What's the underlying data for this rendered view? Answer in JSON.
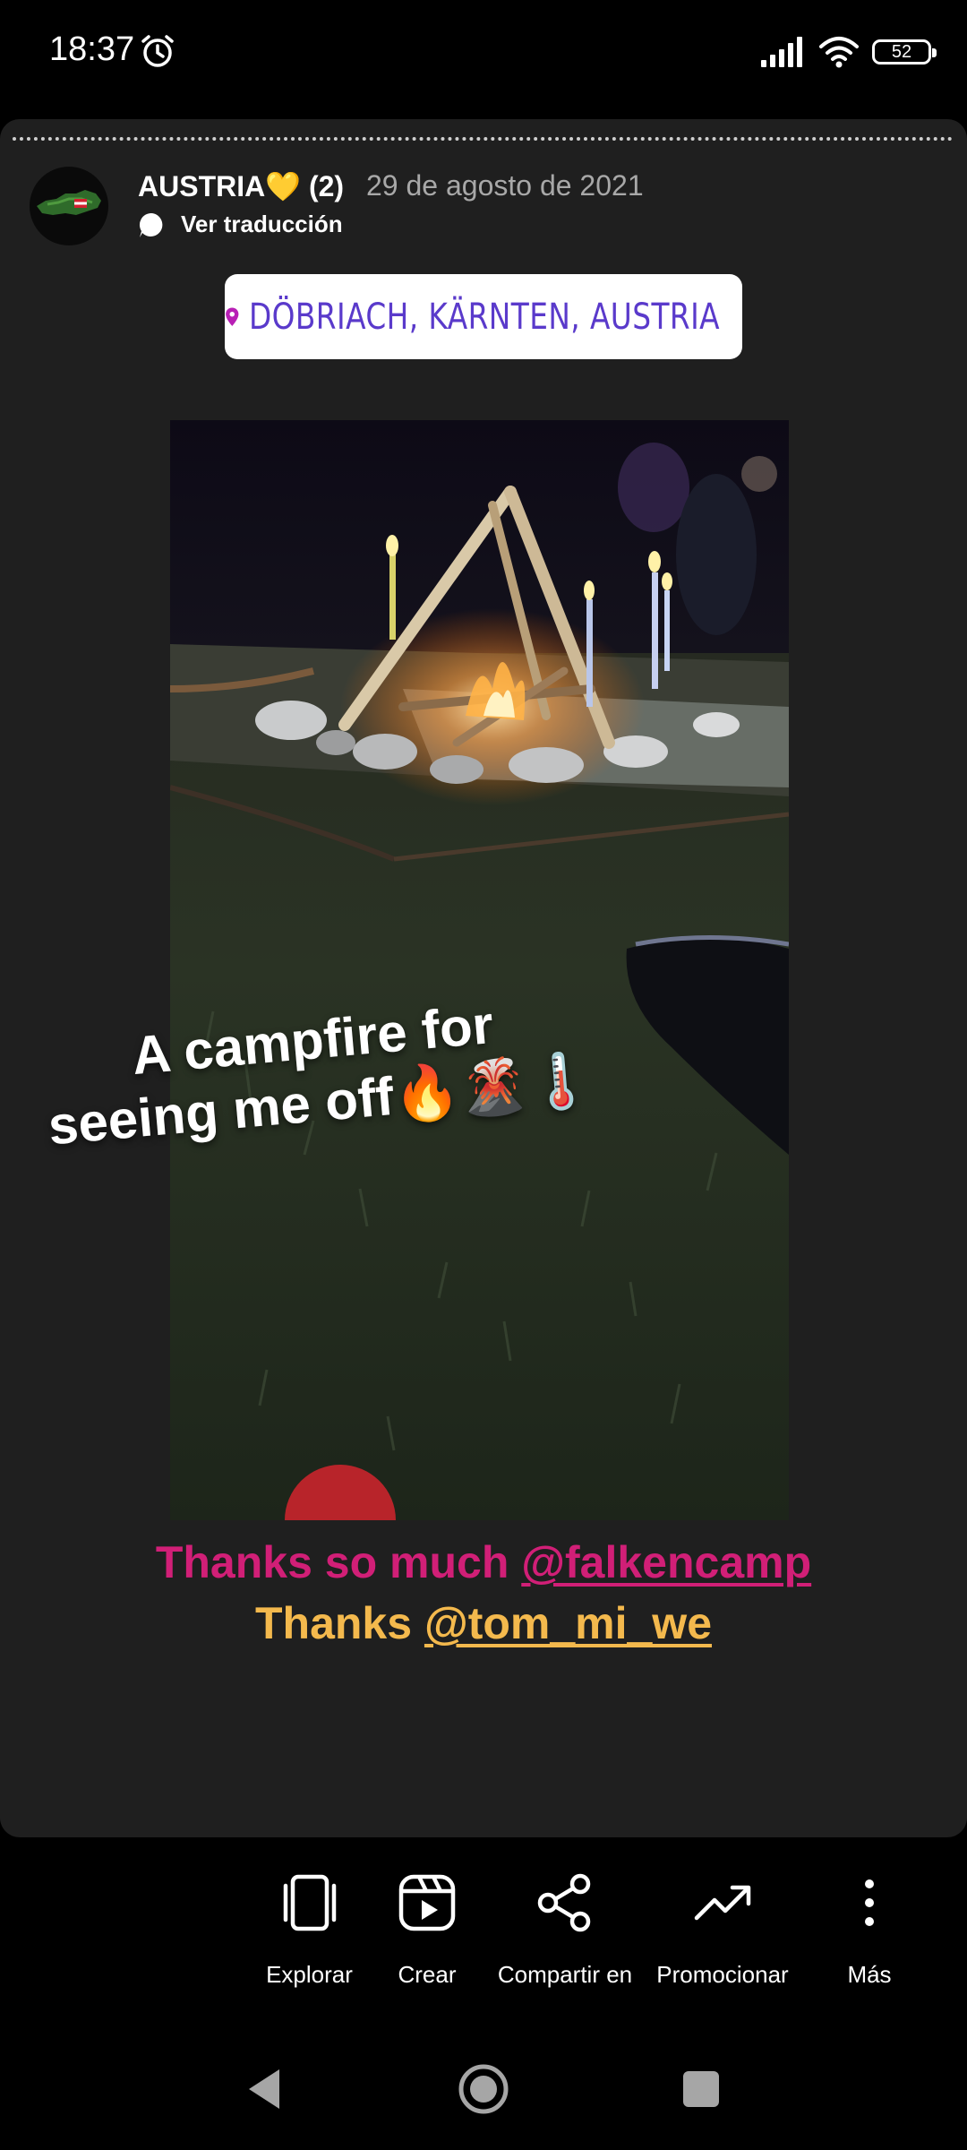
{
  "status_bar": {
    "time": "18:37",
    "battery": "52",
    "icons": [
      "alarm-icon",
      "signal-icon",
      "wifi-icon",
      "battery-icon"
    ]
  },
  "story": {
    "username": "AUSTRIA💛 (2)",
    "date": "29 de agosto de 2021",
    "translate_label": "Ver traducción",
    "location": "DÖBRIACH, KÄRNTEN, AUSTRIA",
    "overlay_line1": "A campfire for",
    "overlay_line2": "seeing me off🔥🌋🌡️",
    "caption_line1_prefix": "Thanks so much ",
    "caption_line1_mention": "@falkencamp",
    "caption_line2_prefix": "Thanks ",
    "caption_line2_mention": "@tom_mi_we"
  },
  "actions": [
    {
      "label": "Explorar",
      "icon": "explore-icon"
    },
    {
      "label": "Crear",
      "icon": "create-icon"
    },
    {
      "label": "Compartir en",
      "icon": "share-icon"
    },
    {
      "label": "Promocionar",
      "icon": "trending-icon"
    },
    {
      "label": "Más",
      "icon": "more-icon"
    }
  ],
  "colors": {
    "background": "#000000",
    "card": "#1f1f1f",
    "caption_pink": "#d11f77",
    "caption_gold": "#f4b94d",
    "location_text": "#5a3acb",
    "pin": "#b81fb5"
  }
}
